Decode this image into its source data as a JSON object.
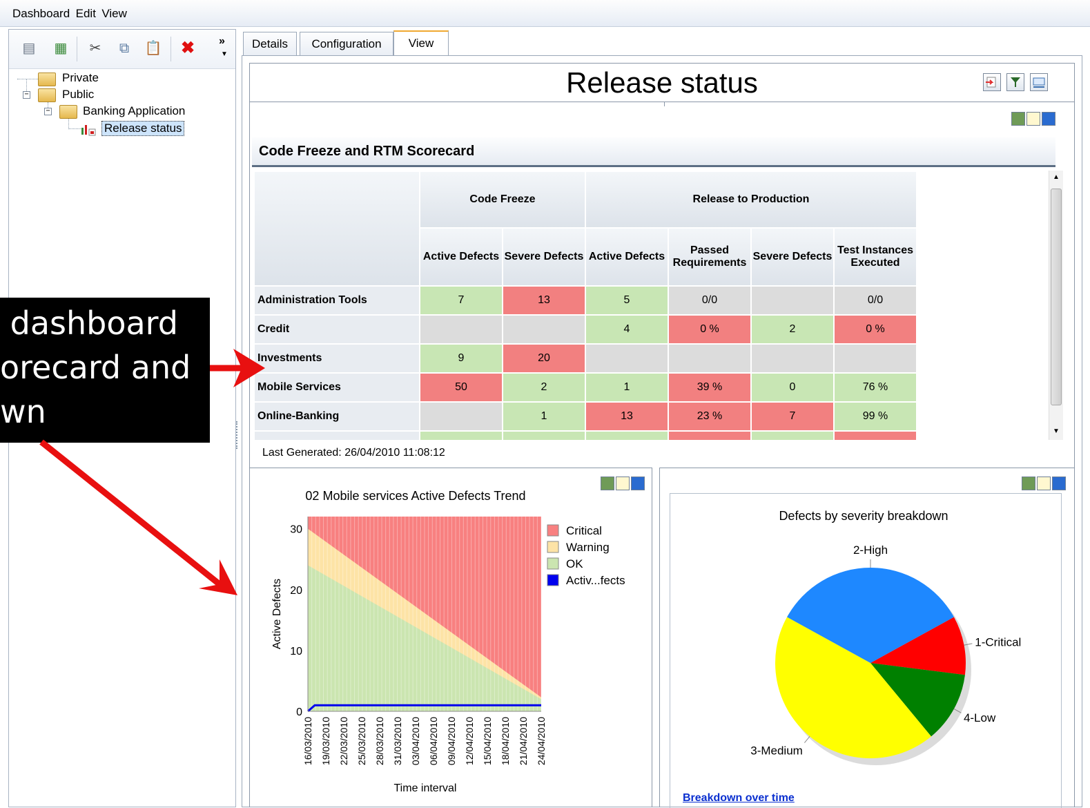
{
  "menu": [
    "Dashboard",
    "Edit",
    "View"
  ],
  "toolbar": {
    "icons": [
      "new-page-icon",
      "add-graph-icon",
      "cut-icon",
      "copy-icon",
      "paste-icon",
      "delete-icon"
    ],
    "overflow": "»"
  },
  "tree": {
    "private": "Private",
    "public": "Public",
    "banking": "Banking Application",
    "release": "Release status"
  },
  "tabs": [
    "Details",
    "Configuration",
    "View"
  ],
  "page_title": "Release status",
  "scorecard": {
    "title": "Code Freeze and RTM Scorecard",
    "group_headers": [
      "Code Freeze",
      "Release to Production"
    ],
    "columns": [
      "Active Defects",
      "Severe Defects",
      "Active Defects",
      "Passed Requirements",
      "Severe Defects",
      "Test Instances Executed"
    ],
    "rows": [
      {
        "name": "Administration Tools",
        "cells": [
          [
            "7",
            "g"
          ],
          [
            "13",
            "r"
          ],
          [
            "5",
            "g"
          ],
          [
            "0/0",
            "n"
          ],
          [
            "",
            "n"
          ],
          [
            "0/0",
            "n"
          ]
        ]
      },
      {
        "name": "Credit",
        "cells": [
          [
            "",
            "n"
          ],
          [
            "",
            "n"
          ],
          [
            "4",
            "g"
          ],
          [
            "0 %",
            "r"
          ],
          [
            "2",
            "g"
          ],
          [
            "0 %",
            "r"
          ]
        ]
      },
      {
        "name": "Investments",
        "cells": [
          [
            "9",
            "g"
          ],
          [
            "20",
            "r"
          ],
          [
            "",
            "n"
          ],
          [
            "",
            "n"
          ],
          [
            "",
            "n"
          ],
          [
            "",
            "n"
          ]
        ]
      },
      {
        "name": "Mobile Services",
        "cells": [
          [
            "50",
            "r"
          ],
          [
            "2",
            "g"
          ],
          [
            "1",
            "g"
          ],
          [
            "39 %",
            "r"
          ],
          [
            "0",
            "g"
          ],
          [
            "76 %",
            "g"
          ]
        ]
      },
      {
        "name": "Online-Banking",
        "cells": [
          [
            "",
            "n"
          ],
          [
            "1",
            "g"
          ],
          [
            "13",
            "r"
          ],
          [
            "23 %",
            "r"
          ],
          [
            "7",
            "r"
          ],
          [
            "99 %",
            "g"
          ]
        ]
      }
    ],
    "last_generated": "Last Generated: 26/04/2010 11:08:12"
  },
  "colors": {
    "green": "#c8e6b4",
    "red": "#f28080",
    "gray": "#dcdcdc"
  },
  "annotation": {
    "line1": " dashboard",
    "line2": "orecard and",
    "line3": "wn"
  },
  "breakdown_link": "Breakdown over time",
  "chart_data": [
    {
      "type": "area",
      "title": "02 Mobile services Active Defects Trend",
      "xlabel": "Time interval",
      "ylabel": "Active Defects",
      "ylim": [
        0,
        32
      ],
      "yticks": [
        0,
        10,
        20,
        30
      ],
      "x": [
        "16/03/2010",
        "19/03/2010",
        "22/03/2010",
        "25/03/2010",
        "28/03/2010",
        "31/03/2010",
        "03/04/2010",
        "06/04/2010",
        "09/04/2010",
        "12/04/2010",
        "15/04/2010",
        "18/04/2010",
        "21/04/2010",
        "24/04/2010"
      ],
      "series": [
        {
          "name": "OK",
          "color": "#cbe5b0",
          "start": 24,
          "end": 2
        },
        {
          "name": "Warning",
          "color": "#fde3a6",
          "start": 30,
          "end": 2.3
        },
        {
          "name": "Critical",
          "color": "#f88080",
          "start": 32,
          "end": 32
        },
        {
          "name": "Activ...fects",
          "color": "#0000ee",
          "start": 0,
          "end": 1
        }
      ],
      "legend": [
        "Critical",
        "Warning",
        "OK",
        "Activ...fects"
      ],
      "legend_colors": [
        "#f88080",
        "#fde3a6",
        "#cbe5b0",
        "#0000ee"
      ]
    },
    {
      "type": "pie",
      "title": "Defects by severity breakdown",
      "labels": [
        "1-Critical",
        "4-Low",
        "3-Medium",
        "2-High"
      ],
      "values": [
        10,
        12,
        44,
        34
      ],
      "colors": [
        "#ff0000",
        "#008000",
        "#ffff00",
        "#1e88ff"
      ]
    }
  ]
}
